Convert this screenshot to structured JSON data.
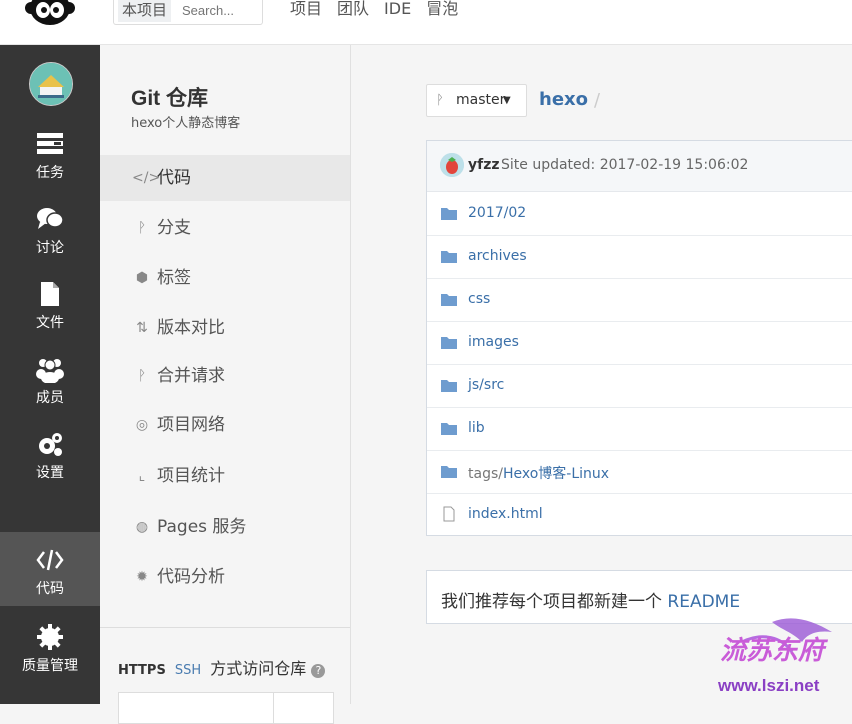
{
  "header": {
    "search_scope": "本项目",
    "search_placeholder": "Search...",
    "nav": [
      "项目",
      "团队",
      "IDE",
      "冒泡"
    ]
  },
  "sidebar": {
    "items": [
      {
        "label": "任务",
        "icon": "tasks-icon"
      },
      {
        "label": "讨论",
        "icon": "comments-icon"
      },
      {
        "label": "文件",
        "icon": "file-icon"
      },
      {
        "label": "成员",
        "icon": "users-icon"
      },
      {
        "label": "设置",
        "icon": "gears-icon"
      },
      {
        "label": "代码",
        "icon": "code-icon",
        "active": true
      },
      {
        "label": "质量管理",
        "icon": "quality-icon"
      }
    ]
  },
  "subnav": {
    "title": "Git 仓库",
    "desc": "hexo个人静态博客",
    "items": [
      {
        "label": "代码",
        "icon": "</>",
        "active": true
      },
      {
        "label": "分支",
        "icon": "ᚹ"
      },
      {
        "label": "标签",
        "icon": "⬢"
      },
      {
        "label": "版本对比",
        "icon": "⇅"
      },
      {
        "label": "合并请求",
        "icon": "ᚹ"
      },
      {
        "label": "项目网络",
        "icon": "◎"
      },
      {
        "label": "项目统计",
        "icon": "⌞"
      },
      {
        "label": "Pages 服务",
        "icon": "◍"
      },
      {
        "label": "代码分析",
        "icon": "✹"
      }
    ],
    "access": {
      "https": "HTTPS",
      "ssh": "SSH",
      "text": "方式访问仓库",
      "help": "?"
    }
  },
  "main": {
    "branch": "master",
    "repo": "hexo",
    "slash": "/",
    "commit": {
      "user": "yfzz",
      "message": "Site updated: 2017-02-19 15:06:02"
    },
    "files": [
      {
        "prefix": "",
        "name": "2017/02",
        "type": "folder"
      },
      {
        "prefix": "",
        "name": "archives",
        "type": "folder"
      },
      {
        "prefix": "",
        "name": "css",
        "type": "folder"
      },
      {
        "prefix": "",
        "name": "images",
        "type": "folder"
      },
      {
        "prefix": "",
        "name": "js/src",
        "type": "folder"
      },
      {
        "prefix": "",
        "name": "lib",
        "type": "folder"
      },
      {
        "prefix": "tags/",
        "name": "Hexo博客-Linux",
        "type": "folder"
      },
      {
        "prefix": "",
        "name": "index.html",
        "type": "file"
      }
    ],
    "readme_text": "我们推荐每个项目都新建一个",
    "readme_link": "README"
  },
  "watermark": {
    "cn": "流苏东府",
    "url": "www.lszi.net"
  },
  "colors": {
    "sidebar": "#363636",
    "link": "#3a6fa8",
    "folder": "#6e9ccf"
  }
}
